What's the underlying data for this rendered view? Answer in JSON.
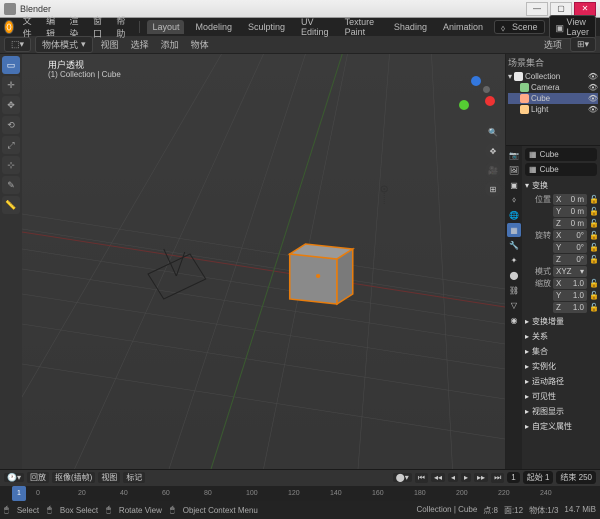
{
  "window": {
    "title": "Blender"
  },
  "menubar": {
    "file": "文件",
    "edit": "编辑",
    "render": "渲染",
    "window": "窗口",
    "help": "帮助",
    "tabs": [
      "Layout",
      "Modeling",
      "Sculpting",
      "UV Editing",
      "Texture Paint",
      "Shading",
      "Animation"
    ],
    "scene_icon": "s",
    "scene": "Scene",
    "viewlayer_icon": "v",
    "viewlayer": "View Layer"
  },
  "modebar": {
    "mode": "物体模式",
    "view": "视图",
    "select": "选择",
    "add": "添加",
    "object": "物体",
    "options": "选项"
  },
  "viewport": {
    "persp": "用户透视",
    "sub": "(1) Collection | Cube",
    "gizmo": {
      "x": "#e33",
      "y": "#5c3",
      "z": "#37d",
      "neg": "#888"
    }
  },
  "outliner": {
    "header": "场景集合",
    "items": [
      {
        "icon": "#e8e8e8",
        "label": "Collection",
        "indent": 0,
        "sel": false
      },
      {
        "icon": "#8c8",
        "label": "Camera",
        "indent": 1,
        "sel": false
      },
      {
        "icon": "#fa8",
        "label": "Cube",
        "indent": 1,
        "sel": true
      },
      {
        "icon": "#fc8",
        "label": "Light",
        "indent": 1,
        "sel": false
      }
    ]
  },
  "props": {
    "crumb1": "Cube",
    "crumb2": "Cube",
    "transform": "变换",
    "loc_label": "位置",
    "loc": {
      "x": "0 m",
      "y": "0 m",
      "z": "0 m"
    },
    "rot_label": "旋转",
    "rot": {
      "x": "0°",
      "y": "0°",
      "z": "0°"
    },
    "rot_mode_label": "模式",
    "rot_mode": "XYZ",
    "scale_label": "缩放",
    "scale": {
      "x": "1.0",
      "y": "1.0",
      "z": "1.0"
    },
    "panels": [
      "变换增量",
      "关系",
      "集合",
      "实例化",
      "运动路径",
      "可见性",
      "视图显示",
      "自定义属性"
    ]
  },
  "timeline": {
    "play_label": "回放",
    "keying": "抠像(插帧)",
    "view": "视图",
    "marker": "标记",
    "current": "1",
    "start_label": "起始",
    "start": "1",
    "end_label": "结束",
    "end": "250",
    "ticks": [
      0,
      20,
      40,
      60,
      80,
      100,
      120,
      140,
      160,
      180,
      200,
      220,
      240
    ]
  },
  "status": {
    "select": "Select",
    "box": "Box Select",
    "rotate": "Rotate View",
    "menu": "Object Context Menu",
    "r_collection": "Collection | Cube",
    "r_verts": "点:8",
    "r_faces": "面:12",
    "r_objects": "物体:1/3",
    "r_mem": "14.7 MiB"
  }
}
